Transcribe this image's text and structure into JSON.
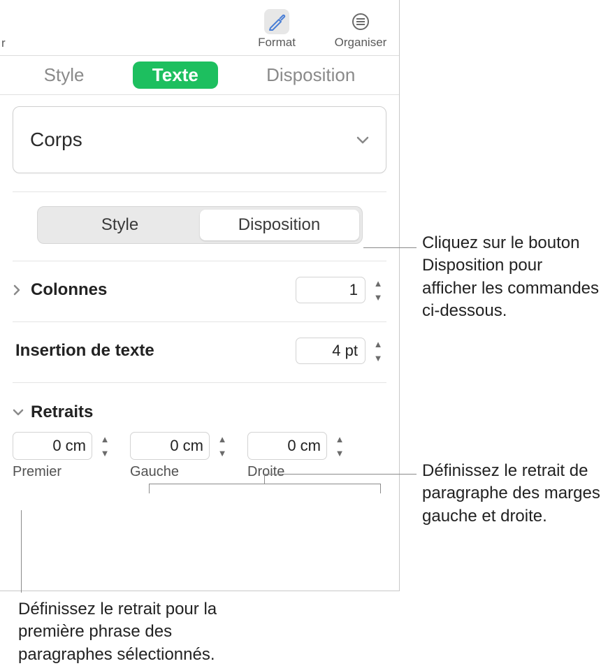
{
  "toolbar": {
    "edge_letter": "r",
    "format": {
      "label": "Format"
    },
    "organiser": {
      "label": "Organiser"
    }
  },
  "tabs": {
    "style": "Style",
    "texte": "Texte",
    "disposition": "Disposition"
  },
  "para_style": {
    "value": "Corps"
  },
  "segmented": {
    "style": "Style",
    "disposition": "Disposition"
  },
  "columns": {
    "label": "Colonnes",
    "value": "1"
  },
  "text_inset": {
    "label": "Insertion de texte",
    "value": "4 pt"
  },
  "indents": {
    "label": "Retraits",
    "first": {
      "value": "0 cm",
      "label": "Premier"
    },
    "left": {
      "value": "0 cm",
      "label": "Gauche"
    },
    "right": {
      "value": "0 cm",
      "label": "Droite"
    }
  },
  "callouts": {
    "disposition_btn": "Cliquez sur le bouton Disposition pour afficher les commandes ci-dessous.",
    "margins": "Définissez le retrait de paragraphe des marges gauche et droite.",
    "first_line": "Définissez le retrait pour la première phrase des paragraphes sélectionnés."
  }
}
